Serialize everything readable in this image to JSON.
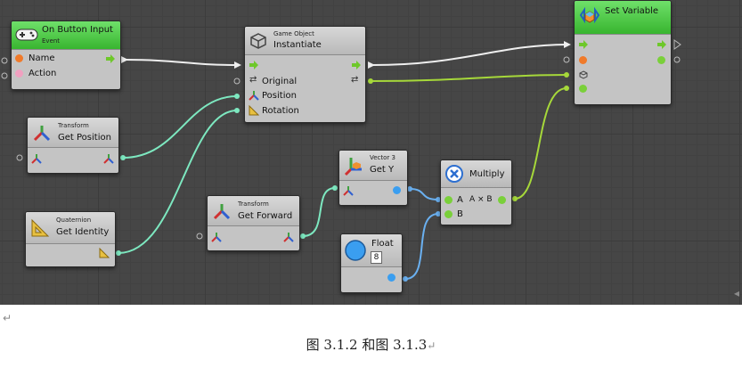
{
  "nodes": {
    "on_button_input": {
      "title": "On Button Input",
      "subtitle": "Event",
      "ports": [
        "Name",
        "Action"
      ]
    },
    "instantiate": {
      "category": "Game Object",
      "title": "Instantiate",
      "ports": [
        "Original",
        "Position",
        "Rotation"
      ]
    },
    "set_variable": {
      "title": "Set Variable"
    },
    "get_position": {
      "category": "Transform",
      "title": "Get Position"
    },
    "get_identity": {
      "category": "Quaternion",
      "title": "Get Identity"
    },
    "get_forward": {
      "category": "Transform",
      "title": "Get Forward"
    },
    "get_y": {
      "category": "Vector 3",
      "title": "Get Y"
    },
    "multiply": {
      "title": "Multiply",
      "formula": "A × B",
      "ports": [
        "A",
        "B"
      ]
    },
    "float": {
      "title": "Float",
      "value": "8"
    }
  },
  "caption": "图 3.1.2 和图 3.1.3",
  "colors": {
    "canvas": "#464646",
    "node_body": "#c4c4c4",
    "event_header": "#44c33a",
    "flow_wire": "#f0f0f0",
    "vector_wire": "#7de8c0",
    "float_wire": "#6ab0f0",
    "number_wire": "#8ac53a"
  }
}
